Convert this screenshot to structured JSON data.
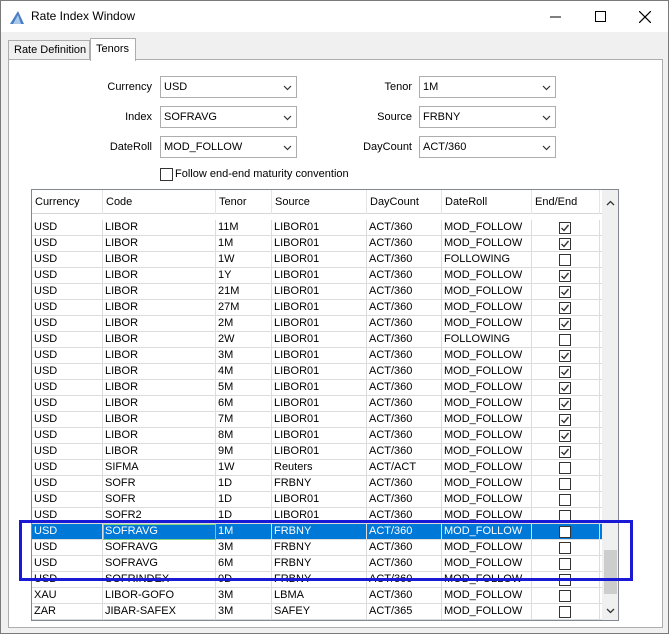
{
  "window": {
    "title": "Rate Index Window"
  },
  "tabs": [
    {
      "label": "Rate Definition",
      "active": false
    },
    {
      "label": "Tenors",
      "active": true
    }
  ],
  "form": {
    "currency_label": "Currency",
    "currency_value": "USD",
    "index_label": "Index",
    "index_value": "SOFRAVG",
    "dateroll_label": "DateRoll",
    "dateroll_value": "MOD_FOLLOW",
    "tenor_label": "Tenor",
    "tenor_value": "1M",
    "source_label": "Source",
    "source_value": "FRBNY",
    "daycount_label": "DayCount",
    "daycount_value": "ACT/360",
    "follow_label": "Follow end-end maturity convention",
    "follow_checked": false
  },
  "table": {
    "headers": [
      "Currency",
      "Code",
      "Tenor",
      "Source",
      "DayCount",
      "DateRoll",
      "End/End"
    ],
    "rows": [
      {
        "currency": "USD",
        "code": "LIBOR",
        "tenor": "11M",
        "source": "LIBOR01",
        "daycount": "ACT/360",
        "dateroll": "MOD_FOLLOW",
        "endend": true
      },
      {
        "currency": "USD",
        "code": "LIBOR",
        "tenor": "1M",
        "source": "LIBOR01",
        "daycount": "ACT/360",
        "dateroll": "MOD_FOLLOW",
        "endend": true
      },
      {
        "currency": "USD",
        "code": "LIBOR",
        "tenor": "1W",
        "source": "LIBOR01",
        "daycount": "ACT/360",
        "dateroll": "FOLLOWING",
        "endend": false
      },
      {
        "currency": "USD",
        "code": "LIBOR",
        "tenor": "1Y",
        "source": "LIBOR01",
        "daycount": "ACT/360",
        "dateroll": "MOD_FOLLOW",
        "endend": true
      },
      {
        "currency": "USD",
        "code": "LIBOR",
        "tenor": "21M",
        "source": "LIBOR01",
        "daycount": "ACT/360",
        "dateroll": "MOD_FOLLOW",
        "endend": true
      },
      {
        "currency": "USD",
        "code": "LIBOR",
        "tenor": "27M",
        "source": "LIBOR01",
        "daycount": "ACT/360",
        "dateroll": "MOD_FOLLOW",
        "endend": true
      },
      {
        "currency": "USD",
        "code": "LIBOR",
        "tenor": "2M",
        "source": "LIBOR01",
        "daycount": "ACT/360",
        "dateroll": "MOD_FOLLOW",
        "endend": true
      },
      {
        "currency": "USD",
        "code": "LIBOR",
        "tenor": "2W",
        "source": "LIBOR01",
        "daycount": "ACT/360",
        "dateroll": "FOLLOWING",
        "endend": false
      },
      {
        "currency": "USD",
        "code": "LIBOR",
        "tenor": "3M",
        "source": "LIBOR01",
        "daycount": "ACT/360",
        "dateroll": "MOD_FOLLOW",
        "endend": true
      },
      {
        "currency": "USD",
        "code": "LIBOR",
        "tenor": "4M",
        "source": "LIBOR01",
        "daycount": "ACT/360",
        "dateroll": "MOD_FOLLOW",
        "endend": true
      },
      {
        "currency": "USD",
        "code": "LIBOR",
        "tenor": "5M",
        "source": "LIBOR01",
        "daycount": "ACT/360",
        "dateroll": "MOD_FOLLOW",
        "endend": true
      },
      {
        "currency": "USD",
        "code": "LIBOR",
        "tenor": "6M",
        "source": "LIBOR01",
        "daycount": "ACT/360",
        "dateroll": "MOD_FOLLOW",
        "endend": true
      },
      {
        "currency": "USD",
        "code": "LIBOR",
        "tenor": "7M",
        "source": "LIBOR01",
        "daycount": "ACT/360",
        "dateroll": "MOD_FOLLOW",
        "endend": true
      },
      {
        "currency": "USD",
        "code": "LIBOR",
        "tenor": "8M",
        "source": "LIBOR01",
        "daycount": "ACT/360",
        "dateroll": "MOD_FOLLOW",
        "endend": true
      },
      {
        "currency": "USD",
        "code": "LIBOR",
        "tenor": "9M",
        "source": "LIBOR01",
        "daycount": "ACT/360",
        "dateroll": "MOD_FOLLOW",
        "endend": true
      },
      {
        "currency": "USD",
        "code": "SIFMA",
        "tenor": "1W",
        "source": "Reuters",
        "daycount": "ACT/ACT",
        "dateroll": "MOD_FOLLOW",
        "endend": false
      },
      {
        "currency": "USD",
        "code": "SOFR",
        "tenor": "1D",
        "source": "FRBNY",
        "daycount": "ACT/360",
        "dateroll": "MOD_FOLLOW",
        "endend": false
      },
      {
        "currency": "USD",
        "code": "SOFR",
        "tenor": "1D",
        "source": "LIBOR01",
        "daycount": "ACT/360",
        "dateroll": "MOD_FOLLOW",
        "endend": false
      },
      {
        "currency": "USD",
        "code": "SOFR2",
        "tenor": "1D",
        "source": "LIBOR01",
        "daycount": "ACT/360",
        "dateroll": "MOD_FOLLOW",
        "endend": false
      },
      {
        "currency": "USD",
        "code": "SOFRAVG",
        "tenor": "1M",
        "source": "FRBNY",
        "daycount": "ACT/360",
        "dateroll": "MOD_FOLLOW",
        "endend": false,
        "selected": true
      },
      {
        "currency": "USD",
        "code": "SOFRAVG",
        "tenor": "3M",
        "source": "FRBNY",
        "daycount": "ACT/360",
        "dateroll": "MOD_FOLLOW",
        "endend": false
      },
      {
        "currency": "USD",
        "code": "SOFRAVG",
        "tenor": "6M",
        "source": "FRBNY",
        "daycount": "ACT/360",
        "dateroll": "MOD_FOLLOW",
        "endend": false
      },
      {
        "currency": "USD",
        "code": "SOFRINDEX",
        "tenor": "0D",
        "source": "FRBNY",
        "daycount": "ACT/360",
        "dateroll": "MOD_FOLLOW",
        "endend": false
      },
      {
        "currency": "XAU",
        "code": "LIBOR-GOFO",
        "tenor": "3M",
        "source": "LBMA",
        "daycount": "ACT/360",
        "dateroll": "MOD_FOLLOW",
        "endend": false
      },
      {
        "currency": "ZAR",
        "code": "JIBAR-SAFEX",
        "tenor": "3M",
        "source": "SAFEY",
        "daycount": "ACT/365",
        "dateroll": "MOD_FOLLOW",
        "endend": false
      }
    ]
  },
  "colors": {
    "selection": "#0078d7",
    "highlight_box": "#1a1ad6"
  }
}
